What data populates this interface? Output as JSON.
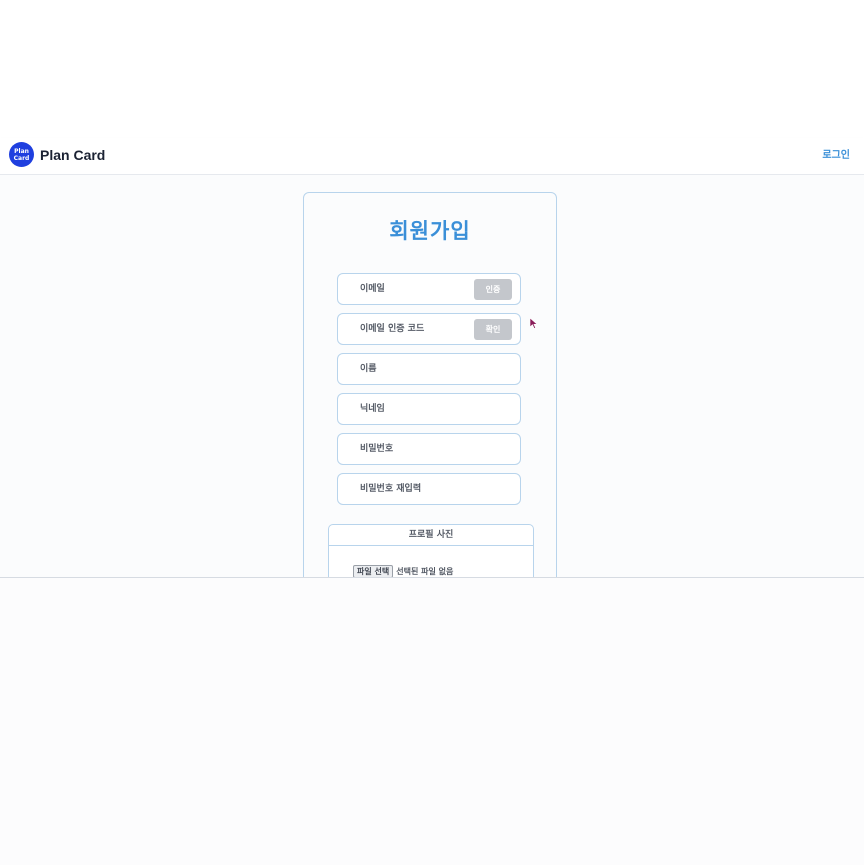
{
  "header": {
    "logo_line1": "Plan",
    "logo_line2": "Card",
    "brand": "Plan Card",
    "login": "로그인"
  },
  "form": {
    "title": "회원가입",
    "fields": [
      {
        "placeholder": "이메일",
        "button": "인증"
      },
      {
        "placeholder": "이메일 인증 코드",
        "button": "확인"
      },
      {
        "placeholder": "이름"
      },
      {
        "placeholder": "닉네임"
      },
      {
        "placeholder": "비밀번호"
      },
      {
        "placeholder": "비밀번호 재입력"
      }
    ],
    "profile": {
      "title": "프로필 사진",
      "file_button": "파일 선택",
      "file_status": "선택된 파일 없음"
    }
  },
  "colors": {
    "accent": "#3a8fd8",
    "logo": "#1f3fdf",
    "disabled_button": "#c4c7cc"
  }
}
